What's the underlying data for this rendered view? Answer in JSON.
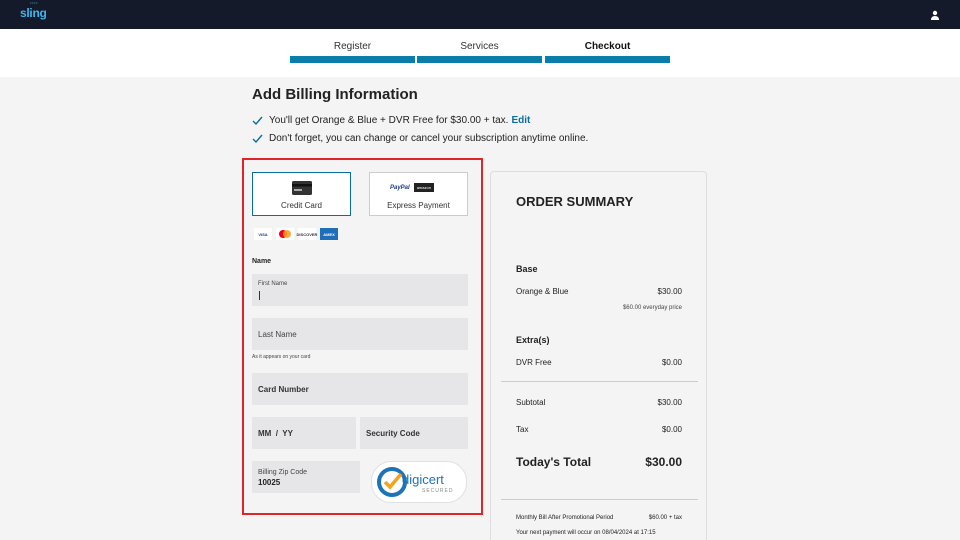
{
  "header": {
    "logo": "sling",
    "logo_dots": "····"
  },
  "steps": [
    {
      "label": "Register"
    },
    {
      "label": "Services"
    },
    {
      "label": "Checkout"
    }
  ],
  "page": {
    "title": "Add Billing Information",
    "bullets": [
      {
        "text": "You'll get Orange & Blue + DVR Free for $30.00 + tax.",
        "link": "Edit"
      },
      {
        "text": "Don't forget, you can change or cancel your subscription anytime online."
      }
    ]
  },
  "payment": {
    "credit_card_label": "Credit Card",
    "express_label": "Express Payment",
    "paypal": "PayPal",
    "amazon": "amazon",
    "cards": [
      "VISA",
      "",
      "DISCOVER",
      "AMEX"
    ]
  },
  "form": {
    "name_label": "Name",
    "first_name_placeholder": "First Name",
    "last_name_placeholder": "Last Name",
    "hint": "As it appears on your card",
    "card_number_placeholder": "Card Number",
    "expiry_placeholder": "MM  /  YY",
    "security_placeholder": "Security Code",
    "zip_label": "Billing Zip Code",
    "zip_value": "10025"
  },
  "digicert": {
    "name": "digicert",
    "sub": "SECURED"
  },
  "summary": {
    "title": "ORDER SUMMARY",
    "base_label": "Base",
    "base_item": "Orange & Blue",
    "base_price": "$30.00",
    "base_note": "$60.00 everyday price",
    "extras_label": "Extra(s)",
    "extra_item": "DVR Free",
    "extra_price": "$0.00",
    "subtotal_label": "Subtotal",
    "subtotal_value": "$30.00",
    "tax_label": "Tax",
    "tax_value": "$0.00",
    "total_label": "Today's Total",
    "total_value": "$30.00",
    "monthly_label": "Monthly Bill After Promotional Period",
    "monthly_value": "$60.00 + tax",
    "next_payment": "Your next payment will occur on 08/04/2024 at 17:15"
  },
  "colors": {
    "accent": "#0a7ea8",
    "highlight_border": "#e0252a",
    "topbar": "#151a2a"
  }
}
